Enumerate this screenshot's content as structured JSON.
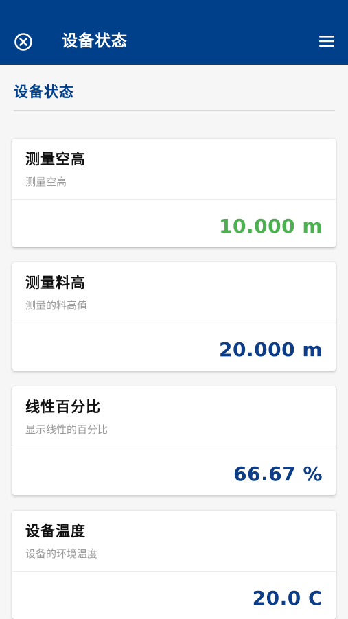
{
  "app_bar": {
    "title": "设备状态",
    "close_icon": "close-circle-icon",
    "menu_icon": "hamburger-menu-icon",
    "background_color": "#003f8a"
  },
  "section": {
    "title": "设备状态"
  },
  "cards": [
    {
      "title": "测量空高",
      "subtitle": "测量空高",
      "value": "10.000 m",
      "value_color": "#4caf50"
    },
    {
      "title": "测量料高",
      "subtitle": "测量的料高值",
      "value": "20.000 m",
      "value_color": "#0d3d86"
    },
    {
      "title": "线性百分比",
      "subtitle": "显示线性的百分比",
      "value": "66.67 %",
      "value_color": "#0d3d86"
    },
    {
      "title": "设备温度",
      "subtitle": "设备的环境温度",
      "value": "20.0 C",
      "value_color": "#0d3d86"
    }
  ]
}
